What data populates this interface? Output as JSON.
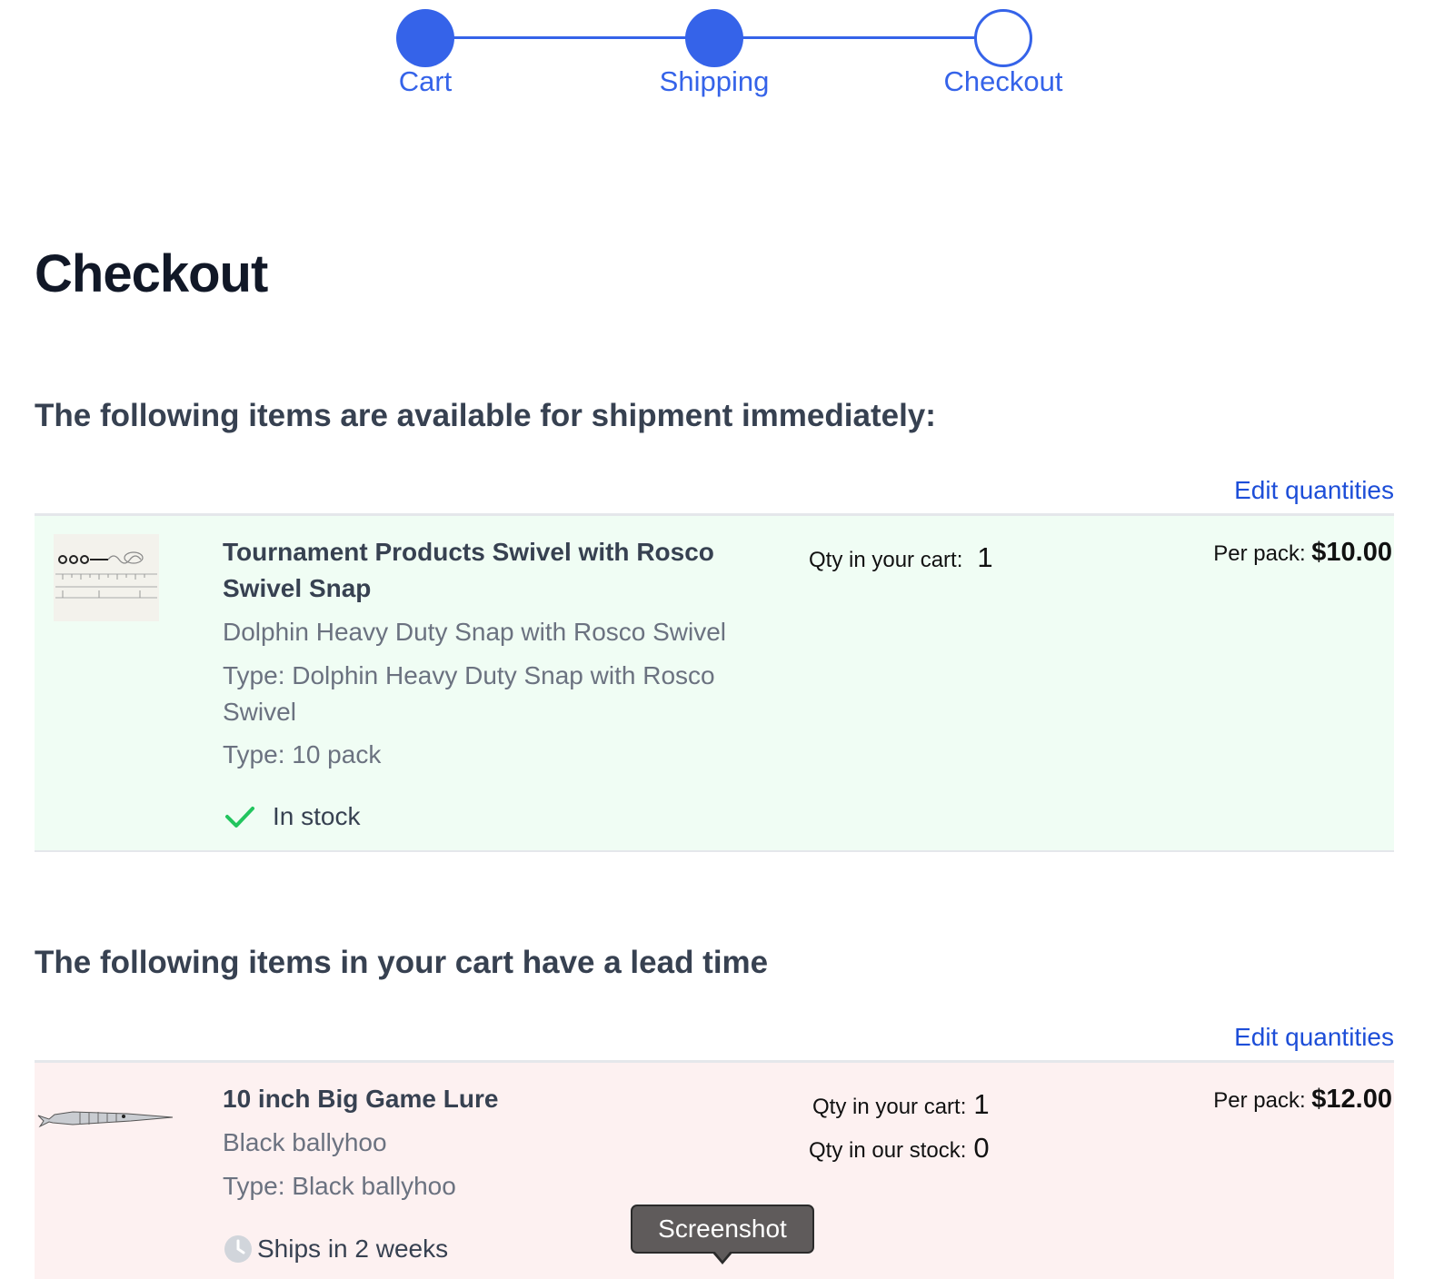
{
  "stepper": {
    "steps": [
      {
        "label": "Cart",
        "state": "complete"
      },
      {
        "label": "Shipping",
        "state": "complete"
      },
      {
        "label": "Checkout",
        "state": "current"
      }
    ],
    "accent_color": "#3563e9"
  },
  "page": {
    "title": "Checkout"
  },
  "available_section": {
    "heading": "The following items are available for shipment immediately:",
    "edit_label": "Edit quantities",
    "items": [
      {
        "title": "Tournament Products Swivel with Rosco Swivel Snap",
        "subtitle": "Dolphin Heavy Duty Snap with Rosco Swivel",
        "type1": "Type: Dolphin Heavy Duty Snap with Rosco Swivel",
        "type2": "Type: 10 pack",
        "status": "In stock",
        "status_icon": "checkmark-icon",
        "qty_label": "Qty in your cart:",
        "qty": "1",
        "price_label": "Per pack:",
        "price": "$10.00"
      }
    ]
  },
  "lead_section": {
    "heading": "The following items in your cart have a lead time",
    "edit_label": "Edit quantities",
    "items": [
      {
        "title": "10 inch Big Game Lure",
        "subtitle": "Black ballyhoo",
        "type1": "Type: Black ballyhoo",
        "status": "Ships in 2 weeks",
        "status_icon": "clock-icon",
        "qty_label": "Qty in your cart:",
        "qty": "1",
        "stock_label": "Qty in our stock:",
        "stock": "0",
        "price_label": "Per pack:",
        "price": "$12.00"
      }
    ]
  },
  "tooltip": {
    "label": "Screenshot"
  }
}
